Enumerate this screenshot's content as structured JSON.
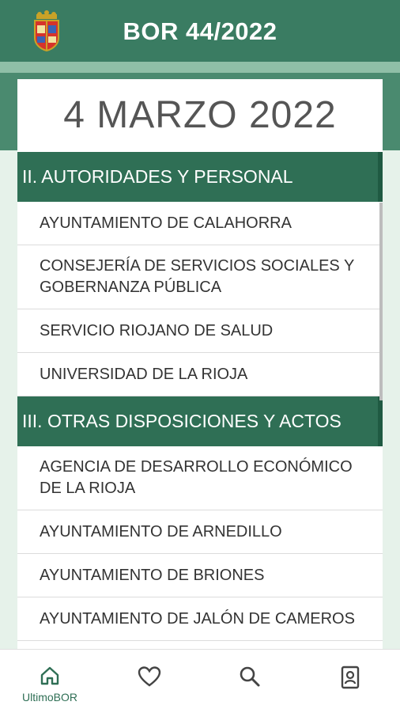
{
  "header": {
    "title": "BOR 44/2022",
    "crest_icon": "coat-of-arms-icon"
  },
  "card": {
    "date": "4 MARZO 2022",
    "sections": [
      {
        "title": "II. AUTORIDADES Y PERSONAL",
        "items": [
          "AYUNTAMIENTO DE CALAHORRA",
          "CONSEJERÍA DE SERVICIOS SOCIALES Y GOBERNANZA PÚBLICA",
          "SERVICIO RIOJANO DE SALUD",
          "UNIVERSIDAD DE LA RIOJA"
        ]
      },
      {
        "title": "III. OTRAS DISPOSICIONES Y ACTOS",
        "items": [
          "AGENCIA DE DESARROLLO ECONÓMICO DE LA RIOJA",
          "AYUNTAMIENTO DE ARNEDILLO",
          "AYUNTAMIENTO DE BRIONES",
          "AYUNTAMIENTO DE JALÓN DE CAMEROS"
        ]
      }
    ]
  },
  "bottom_nav": {
    "tabs": [
      {
        "icon": "home-icon",
        "label": "UltimoBOR",
        "active": true
      },
      {
        "icon": "heart-icon",
        "label": "",
        "active": false
      },
      {
        "icon": "search-icon",
        "label": "",
        "active": false
      },
      {
        "icon": "contact-card-icon",
        "label": "",
        "active": false
      }
    ]
  },
  "colors": {
    "primary": "#3a7c62",
    "section": "#2f6f55",
    "background": "#e6f2ea"
  }
}
